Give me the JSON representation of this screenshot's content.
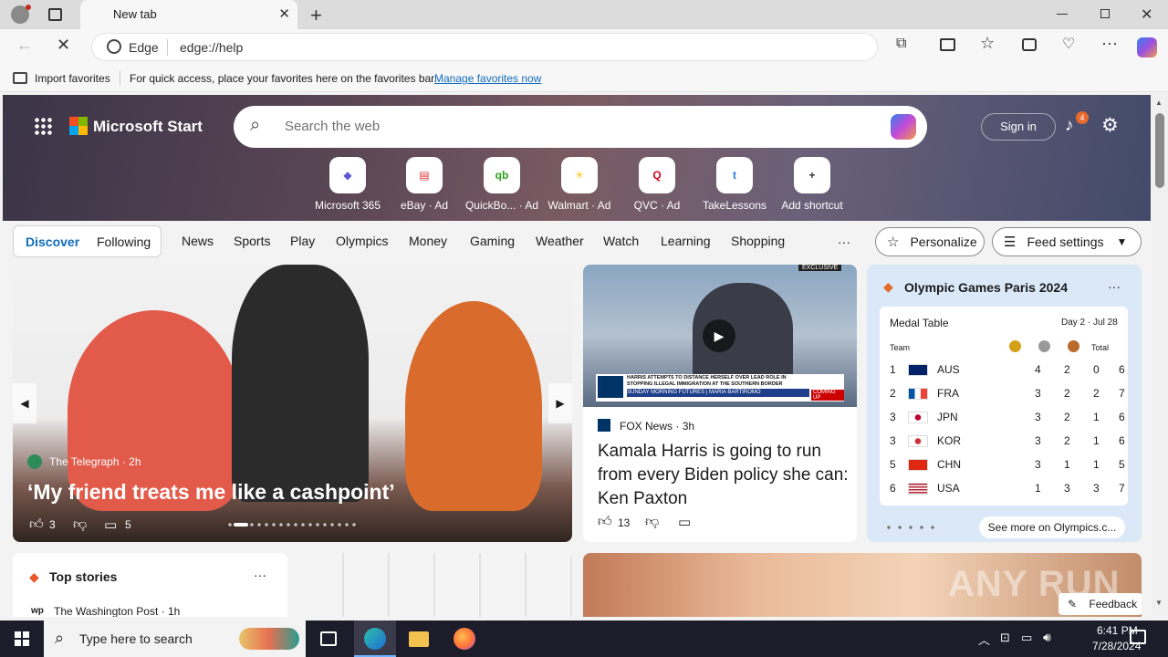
{
  "browser": {
    "tab_title": "New tab",
    "address_site": "Edge",
    "address_url": "edge://help"
  },
  "favbar": {
    "import_label": "Import favorites",
    "hint": "For quick access, place your favorites here on the favorites bar.",
    "manage_link": "Manage favorites now"
  },
  "header": {
    "logo_text": "Microsoft Start",
    "search_placeholder": "Search the web",
    "signin_label": "Sign in",
    "notif_count": "4"
  },
  "shortcuts": [
    {
      "label": "Microsoft 365",
      "icon": "microsoft365-icon",
      "glyph": "◆",
      "color": "#5b5bd6"
    },
    {
      "label": "eBay · Ad",
      "icon": "ebay-icon",
      "glyph": "▤",
      "color": "#e53238"
    },
    {
      "label": "QuickBo... · Ad",
      "icon": "quickbooks-icon",
      "glyph": "qb",
      "color": "#2ca01c"
    },
    {
      "label": "Walmart · Ad",
      "icon": "walmart-icon",
      "glyph": "✳",
      "color": "#ffc220"
    },
    {
      "label": "QVC · Ad",
      "icon": "qvc-icon",
      "glyph": "Q",
      "color": "#d0021b"
    },
    {
      "label": "TakeLessons",
      "icon": "takelessons-icon",
      "glyph": "t",
      "color": "#2a7de1"
    },
    {
      "label": "Add shortcut",
      "icon": "plus-icon",
      "glyph": "+",
      "color": "#333"
    }
  ],
  "nav": {
    "discover": "Discover",
    "following": "Following",
    "items": [
      "News",
      "Sports",
      "Play",
      "Olympics",
      "Money",
      "Gaming",
      "Weather",
      "Watch",
      "Learning",
      "Shopping"
    ],
    "more": "···",
    "personalize": "Personalize",
    "feed_settings": "Feed settings"
  },
  "hero_story": {
    "source": "The Telegraph",
    "age": "2h",
    "title": "‘My friend treats me like a cashpoint’",
    "likes": "3",
    "comments": "5"
  },
  "fox_story": {
    "badge": "EXCLUSIVE",
    "ticker1": "HARRIS ATTEMPTS TO DISTANCE HERSELF OVER LEAD ROLE IN STOPPING ILLEGAL IMMIGRATION AT THE SOUTHERN BORDER",
    "ticker2": "SUNDAY MORNING FUTURES",
    "ticker_name": "MARIA BARTIROMO",
    "coming_up": "COMING UP",
    "source": "FOX News",
    "age": "3h",
    "title": "Kamala Harris is going to run from every Biden policy she can: Ken Paxton",
    "likes": "13"
  },
  "olympics": {
    "title": "Olympic Games Paris 2024",
    "table_title": "Medal Table",
    "day": "Day 2 · Jul 28",
    "col_team": "Team",
    "col_total": "Total",
    "rows": [
      {
        "rank": "1",
        "code": "AUS",
        "g": "4",
        "s": "2",
        "b": "0",
        "t": "6"
      },
      {
        "rank": "2",
        "code": "FRA",
        "g": "3",
        "s": "2",
        "b": "2",
        "t": "7"
      },
      {
        "rank": "3",
        "code": "JPN",
        "g": "3",
        "s": "2",
        "b": "1",
        "t": "6"
      },
      {
        "rank": "3",
        "code": "KOR",
        "g": "3",
        "s": "2",
        "b": "1",
        "t": "6"
      },
      {
        "rank": "5",
        "code": "CHN",
        "g": "3",
        "s": "1",
        "b": "1",
        "t": "5"
      },
      {
        "rank": "6",
        "code": "USA",
        "g": "1",
        "s": "3",
        "b": "3",
        "t": "7"
      }
    ],
    "see_more": "See more on Olympics.c..."
  },
  "top_stories": {
    "title": "Top stories",
    "source": "The Washington Post · 1h"
  },
  "feedback": "Feedback",
  "watermark": "ANY RUN",
  "taskbar": {
    "search_placeholder": "Type here to search",
    "time": "6:41 PM",
    "date": "7/28/2024"
  },
  "colors": {
    "accent": "#0f6cbd",
    "hero_bg": "#5a4655",
    "taskbar": "#1c1c2b"
  }
}
